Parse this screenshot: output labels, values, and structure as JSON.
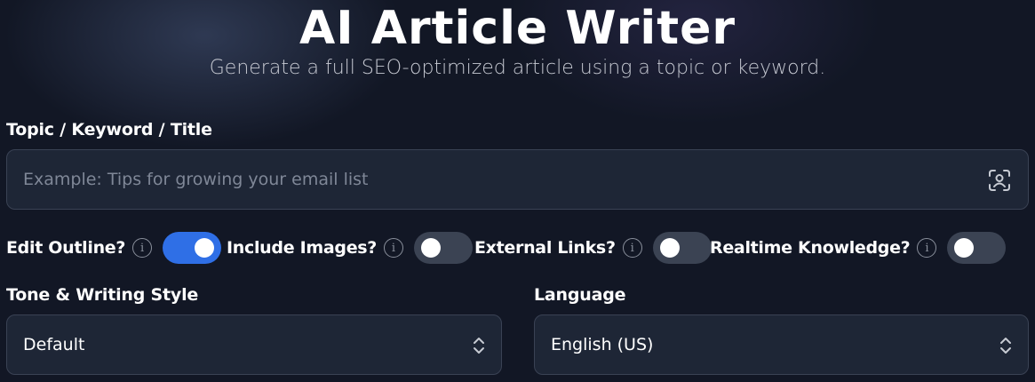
{
  "header": {
    "title": "AI Article Writer",
    "subtitle": "Generate a full SEO-optimized article using a topic or keyword."
  },
  "topic": {
    "label": "Topic / Keyword / Title",
    "placeholder": "Example: Tips for growing your email list",
    "value": "",
    "icon": "voice-recognition-icon"
  },
  "toggles": [
    {
      "label": "Edit Outline?",
      "on": true
    },
    {
      "label": "Include Images?",
      "on": false
    },
    {
      "label": "External Links?",
      "on": false
    },
    {
      "label": "Realtime Knowledge?",
      "on": false
    }
  ],
  "info_glyph": "i",
  "tone": {
    "label": "Tone & Writing Style",
    "value": "Default"
  },
  "language": {
    "label": "Language",
    "value": "English (US)"
  },
  "colors": {
    "background": "#121725",
    "field_bg": "#1e2636",
    "toggle_on": "#2f6fe6",
    "toggle_off": "#3b4353"
  }
}
